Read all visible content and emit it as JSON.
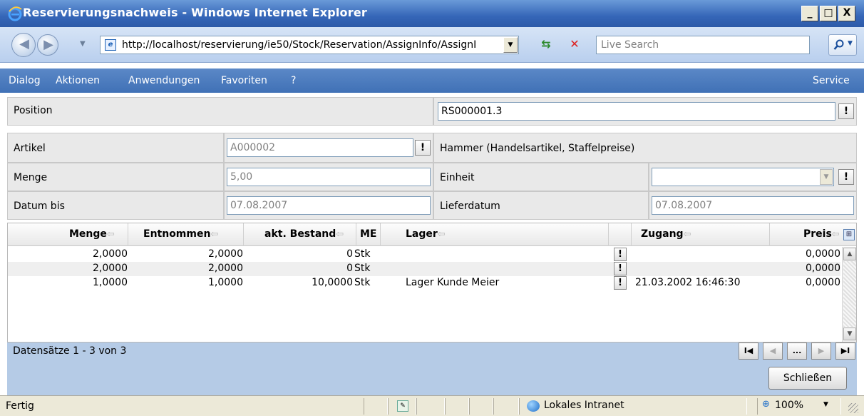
{
  "window": {
    "title": "Reservierungsnachweis - Windows Internet Explorer",
    "min": "_",
    "max": "□",
    "close": "X"
  },
  "address": {
    "url": "http://localhost/reservierung/ie50/Stock/Reservation/AssignInfo/AssignI",
    "search_placeholder": "Live Search"
  },
  "menu": {
    "items": [
      "Dialog",
      "Aktionen",
      "Anwendungen",
      "Favoriten",
      "?"
    ],
    "service": "Service"
  },
  "form": {
    "position_label": "Position",
    "position_value": "RS000001.3",
    "artikel_label": "Artikel",
    "artikel_value": "A000002",
    "artikel_desc": "Hammer (Handelsartikel, Staffelpreise)",
    "menge_label": "Menge",
    "menge_value": "5,00",
    "einheit_label": "Einheit",
    "einheit_value": "",
    "datum_label": "Datum bis",
    "datum_value": "07.08.2007",
    "liefer_label": "Lieferdatum",
    "liefer_value": "07.08.2007",
    "lookup_glyph": "!"
  },
  "grid": {
    "columns": {
      "menge": "Menge",
      "entnommen": "Entnommen",
      "bestand": "akt. Bestand",
      "me": "ME",
      "lager": "Lager",
      "zugang": "Zugang",
      "preis": "Preis"
    },
    "sort_glyph": "⇦",
    "rows": [
      {
        "menge": "2,0000",
        "entnommen": "2,0000",
        "bestand": "0",
        "me": "Stk",
        "lager": "",
        "zugang": "",
        "preis": "0,0000"
      },
      {
        "menge": "2,0000",
        "entnommen": "2,0000",
        "bestand": "0",
        "me": "Stk",
        "lager": "",
        "zugang": "",
        "preis": "0,0000"
      },
      {
        "menge": "1,0000",
        "entnommen": "1,0000",
        "bestand": "10,0000",
        "me": "Stk",
        "lager": "Lager Kunde Meier",
        "zugang": "21.03.2002 16:46:30",
        "preis": "0,0000"
      }
    ],
    "records": "Datensätze 1 - 3 von 3",
    "pager": {
      "first": "I◀",
      "prev": "◀",
      "more": "...",
      "next": "▶",
      "last": "▶I"
    },
    "close_label": "Schließen"
  },
  "status": {
    "text": "Fertig",
    "zone": "Lokales Intranet",
    "zoom": "100%"
  }
}
